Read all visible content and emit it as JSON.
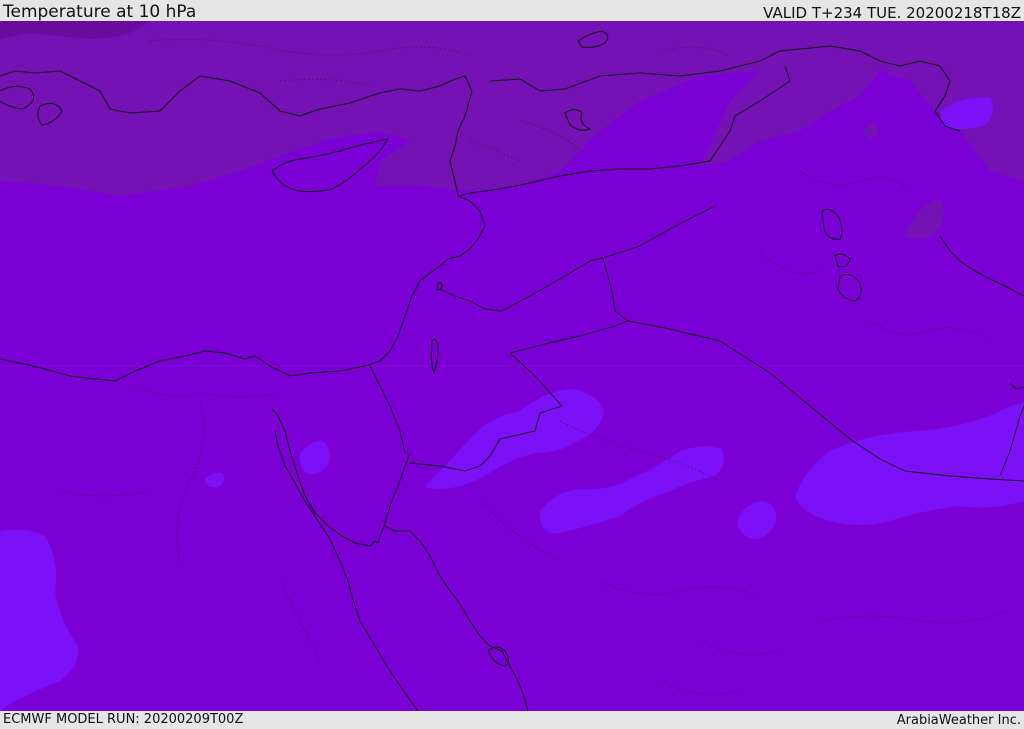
{
  "header": {
    "title": "Temperature at 10 hPa",
    "valid": "VALID T+234 TUE. 20200218T18Z"
  },
  "footer": {
    "model_run": "ECMWF MODEL RUN: 20200209T00Z",
    "credit": "ArabiaWeather Inc."
  },
  "map": {
    "field": "temperature",
    "level": "10 hPa",
    "colors": {
      "base": "#7a00d6",
      "cool_north": "#7412b6",
      "coldest": "#6a0a9e",
      "warm_patch": "#7c10f6"
    }
  }
}
